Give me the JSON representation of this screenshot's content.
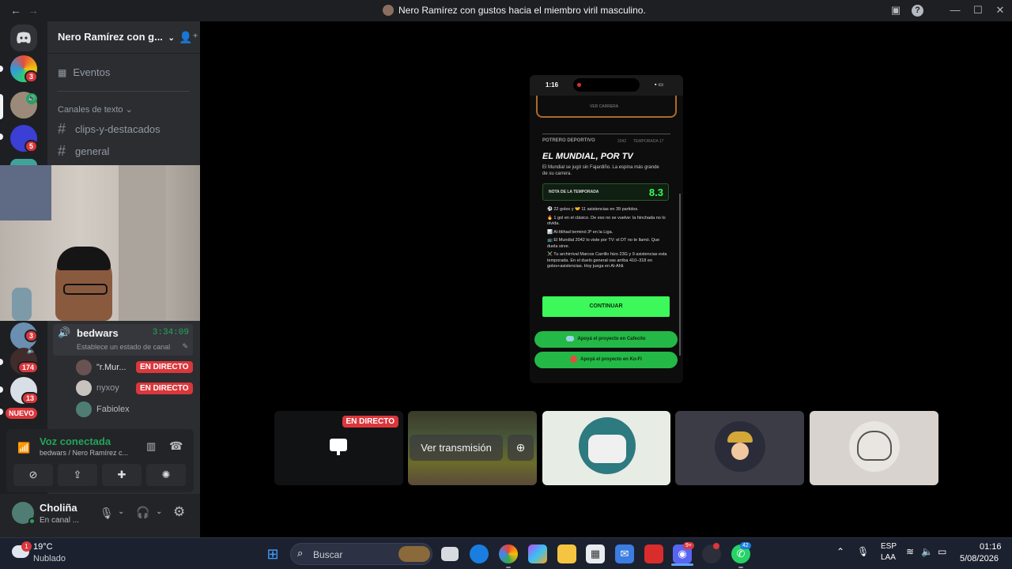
{
  "window": {
    "title": "Nero Ramírez con gustos hacia el miembro viril masculino."
  },
  "rail": {
    "badges": [
      "3",
      "5",
      "3",
      "174",
      "13"
    ],
    "new_label": "NUEVO"
  },
  "sidebar": {
    "server_name": "Nero Ramírez con g...",
    "events_label": "Eventos",
    "category": "Canales de texto",
    "channels": [
      "clips-y-destacados",
      "general"
    ]
  },
  "voice_channel": {
    "name": "bedwars",
    "timer": "3:34:09",
    "status_placeholder": "Establece un estado de canal",
    "users": [
      {
        "name": "\"r.Mur...",
        "live": "EN DIRECTO"
      },
      {
        "name": "nyxoy",
        "live": "EN DIRECTO"
      },
      {
        "name": "Fabiolex",
        "live": ""
      }
    ]
  },
  "voice_panel": {
    "status": "Voz conectada",
    "location": "bedwars / Nero Ramírez c..."
  },
  "user": {
    "name": "Choliña",
    "status": "En canal ..."
  },
  "stream": {
    "phone_time": "1:16",
    "game": {
      "pre_label": "VER CARRERA",
      "section": "POTRERO DEPORTIVO",
      "year": "2042",
      "season": "TEMPORADA 17",
      "headline": "EL MUNDIAL, POR TV",
      "subtitle": "El Mundial se jugó sin Fajardiño. La espina más grande de su carrera.",
      "rating_label": "NOTA DE LA TEMPORADA",
      "rating": "8.3",
      "bullets": [
        "⚽ 22 goles y 🤝 11 asistencias en 39 partidos.",
        "🔥 1 gol en el clásico. De eso no se vuelve: la hinchada no lo olvida.",
        "📊 Al-Ittihad terminó 3º en la Liga.",
        "📺 El Mundial 2042 lo viste por TV: el DT no te llamó. Que duela sirve.",
        "⚔️ Tu archirrival Marcos Carrillo hizo 23G y 9 asistencias esta temporada. En el duelo general vas arriba 410–318 en goles+asistencias. Hoy juega en Al-Ahli."
      ],
      "continue": "CONTINUAR",
      "support1": "Apoyá el proyecto en Cafecito",
      "support2": "Apoyá el proyecto en Ko-Fi"
    }
  },
  "tiles": {
    "live_badge": "EN DIRECTO",
    "watch_label": "Ver transmisión"
  },
  "taskbar": {
    "weather_temp": "19°C",
    "weather_desc": "Nublado",
    "weather_badge": "1",
    "search_label": "Buscar",
    "discord_badge": "9+",
    "whatsapp_badge": "42",
    "lang1": "ESP",
    "lang2": "LAA",
    "time": "01:16",
    "date": "5/08/2026"
  },
  "colors": {
    "accent_green": "#23a55a",
    "live_red": "#da373c",
    "game_green": "#3cf85a"
  }
}
